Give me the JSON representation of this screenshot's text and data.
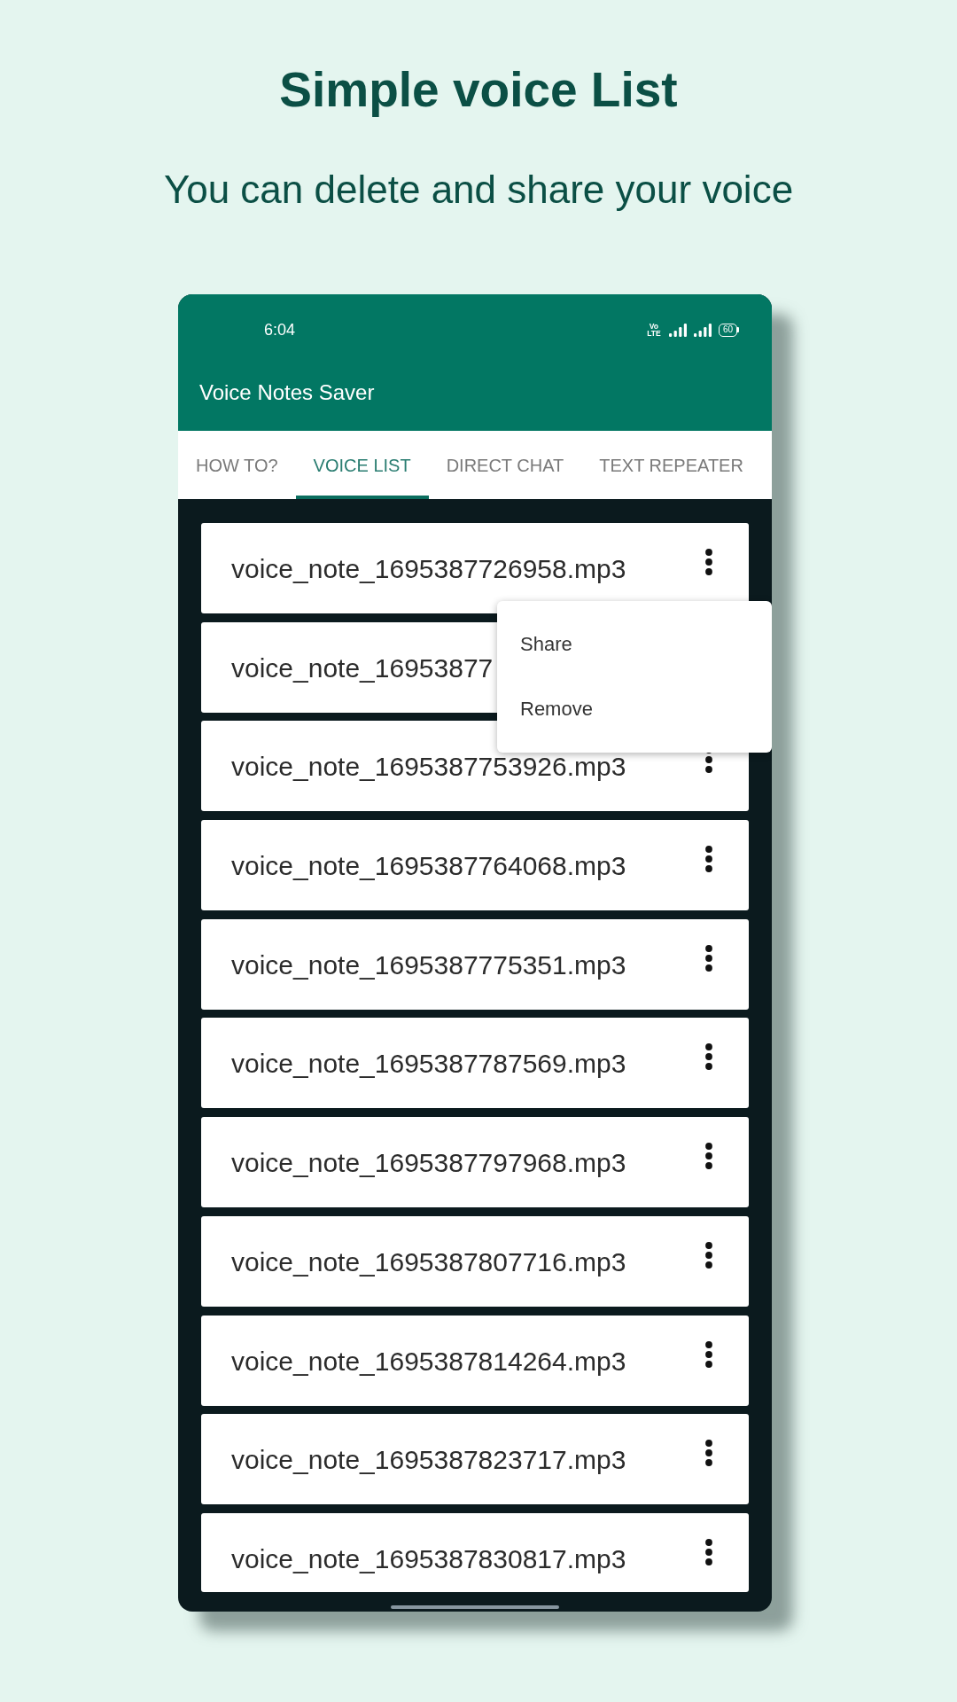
{
  "header": {
    "title": "Simple voice List",
    "subtitle": "You can delete and share your voice"
  },
  "phone": {
    "status_bar": {
      "time": "6:04",
      "network": "Vo LTE",
      "battery": "60"
    },
    "app_bar": {
      "title": "Voice Notes Saver"
    },
    "tabs": [
      {
        "label": "HOW TO?",
        "selected": false
      },
      {
        "label": "VOICE LIST",
        "selected": true
      },
      {
        "label": "DIRECT CHAT",
        "selected": false
      },
      {
        "label": "TEXT REPEATER",
        "selected": false
      }
    ],
    "voice_list": [
      {
        "name": "voice_note_1695387726958.mp3",
        "menu_button": true
      },
      {
        "name": "voice_note_16953877",
        "menu_button": false
      },
      {
        "name": "voice_note_1695387753926.mp3",
        "menu_button": true
      },
      {
        "name": "voice_note_1695387764068.mp3",
        "menu_button": true
      },
      {
        "name": "voice_note_1695387775351.mp3",
        "menu_button": true
      },
      {
        "name": "voice_note_1695387787569.mp3",
        "menu_button": true
      },
      {
        "name": "voice_note_1695387797968.mp3",
        "menu_button": true
      },
      {
        "name": "voice_note_1695387807716.mp3",
        "menu_button": true
      },
      {
        "name": "voice_note_1695387814264.mp3",
        "menu_button": true
      },
      {
        "name": "voice_note_1695387823717.mp3",
        "menu_button": true
      },
      {
        "name": "voice_note_1695387830817.mp3",
        "menu_button": true
      }
    ],
    "popup_menu": {
      "items": [
        "Share",
        "Remove"
      ]
    }
  }
}
